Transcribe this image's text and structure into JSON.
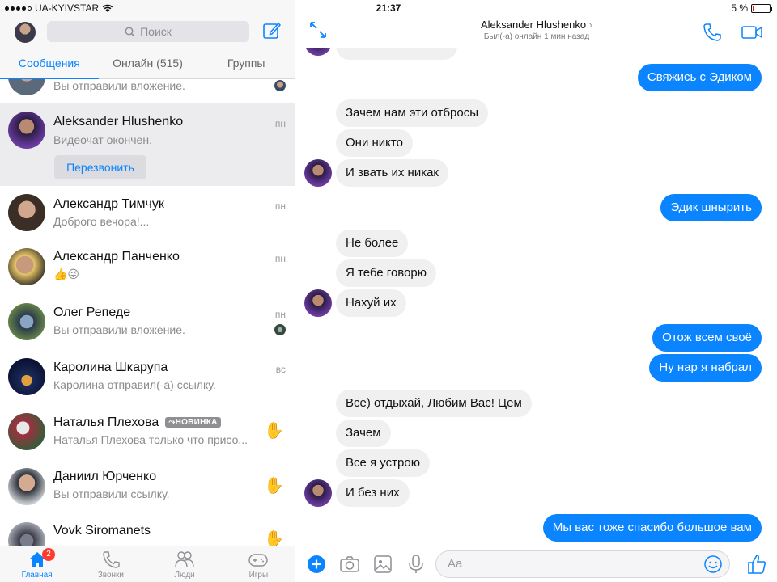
{
  "status": {
    "carrier": "UA-KYIVSTAR",
    "time": "21:37",
    "battery": "5 %"
  },
  "sidebar": {
    "search_placeholder": "Поиск",
    "tabs": [
      {
        "label": "Сообщения",
        "active": true
      },
      {
        "label": "Онлайн (515)",
        "active": false
      },
      {
        "label": "Группы",
        "active": false
      }
    ],
    "conversations": [
      {
        "name": "",
        "preview": "Вы отправили вложение.",
        "time": ""
      },
      {
        "name": "Aleksander Hlushenko",
        "preview": "Видеочат окончен.",
        "time": "пн",
        "action": "Перезвонить",
        "selected": true
      },
      {
        "name": "Александр Тимчук",
        "preview": "Доброго вечора!...",
        "time": "пн"
      },
      {
        "name": "Александр Панченко",
        "preview": "👍😜",
        "time": "пн"
      },
      {
        "name": "Олег Репеде",
        "preview": "Вы отправили вложение.",
        "time": "пн"
      },
      {
        "name": "Каролина Шкарупа",
        "preview": "Каролина отправил(-а) ссылку.",
        "time": "вс"
      },
      {
        "name": "Наталья Плехова",
        "badge": "НОВИНКА",
        "preview": "Наталья Плехова только что присо...",
        "time": ""
      },
      {
        "name": "Даниил Юрченко",
        "preview": "Вы отправили ссылку.",
        "time": ""
      },
      {
        "name": "Vovk Siromanets",
        "preview": "",
        "time": ""
      }
    ],
    "bottom_nav": [
      {
        "label": "Главная",
        "active": true,
        "badge": "2"
      },
      {
        "label": "Звонки",
        "active": false
      },
      {
        "label": "Люди",
        "active": false
      },
      {
        "label": "Игры",
        "active": false
      }
    ]
  },
  "chat": {
    "peer_name": "Aleksander Hlushenko",
    "peer_status": "Был(-а) онлайн 1 мин назад",
    "composer_placeholder": "Aa",
    "messages": [
      {
        "dir": "out",
        "text": "Свяжись с Эдиком"
      },
      {
        "dir": "in",
        "text": "Зачем нам эти отбросы"
      },
      {
        "dir": "in",
        "text": "Они никто"
      },
      {
        "dir": "in",
        "text": "И звать их никак"
      },
      {
        "dir": "out",
        "text": "Эдик шнырить"
      },
      {
        "dir": "in",
        "text": "Не более"
      },
      {
        "dir": "in",
        "text": "Я тебе говорю"
      },
      {
        "dir": "in",
        "text": "Нахуй их"
      },
      {
        "dir": "out",
        "text": "Отож всем своё"
      },
      {
        "dir": "out",
        "text": "Ну нар я набрал"
      },
      {
        "dir": "in",
        "text": "Все) отдыхай, Любим Вас! Цем"
      },
      {
        "dir": "in",
        "text": "Зачем"
      },
      {
        "dir": "in",
        "text": "Все я устрою"
      },
      {
        "dir": "in",
        "text": "И без них"
      },
      {
        "dir": "out",
        "text": "Мы вас тоже спасибо большое вам"
      }
    ]
  },
  "colors": {
    "accent": "#0a84ff",
    "incoming_bubble": "#f1f0f0",
    "badge": "#ff3b30"
  }
}
